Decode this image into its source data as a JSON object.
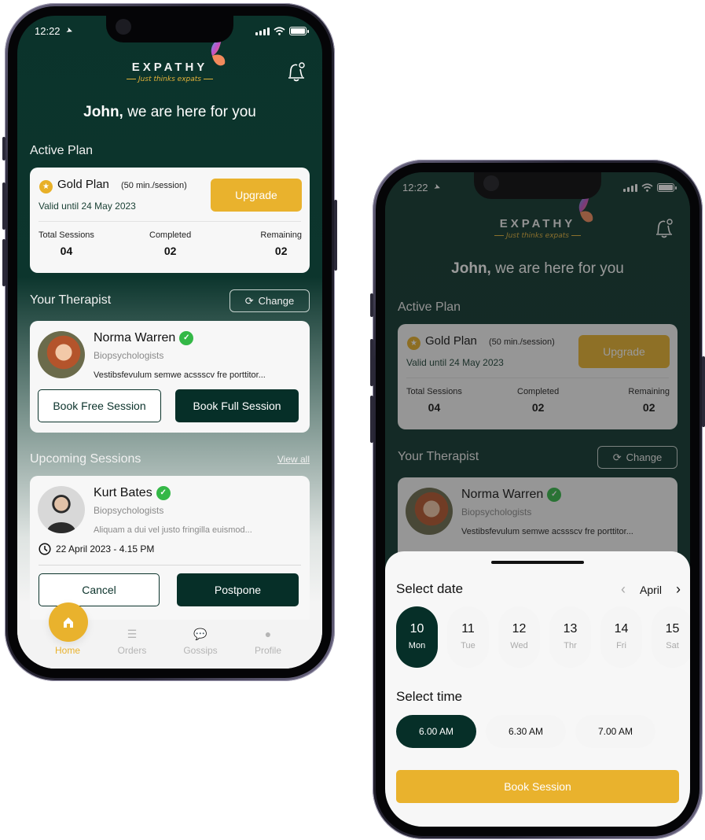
{
  "status_bar": {
    "time": "12:22"
  },
  "header": {
    "brand": "EXPATHY",
    "tagline": "Just thinks expats",
    "greeting_name": "John,",
    "greeting_rest": " we are here for you"
  },
  "active_plan": {
    "section_title": "Active Plan",
    "plan_name": "Gold Plan",
    "plan_duration": "(50 min./session)",
    "valid_until": "Valid until 24 May 2023",
    "upgrade_label": "Upgrade",
    "stats": [
      {
        "label": "Total Sessions",
        "value": "04"
      },
      {
        "label": "Completed",
        "value": "02"
      },
      {
        "label": "Remaining",
        "value": "02"
      }
    ]
  },
  "therapist": {
    "section_title": "Your Therapist",
    "change_label": "Change",
    "name": "Norma Warren",
    "specialty": "Biopsychologists",
    "description": "Vestibsfevulum semwe acssscv fre porttitor...",
    "book_free_label": "Book Free Session",
    "book_full_label": "Book Full Session"
  },
  "upcoming": {
    "section_title": "Upcoming Sessions",
    "view_all_label": "View all",
    "name": "Kurt Bates",
    "specialty": "Biopsychologists",
    "description": "Aliquam a dui vel justo fringilla euismod...",
    "datetime": "22 April 2023 - 4.15 PM",
    "cancel_label": "Cancel",
    "postpone_label": "Postpone"
  },
  "tabbar": {
    "items": [
      {
        "label": "Home",
        "icon": "home-icon",
        "active": true
      },
      {
        "label": "Orders",
        "icon": "list-icon",
        "active": false
      },
      {
        "label": "Gossips",
        "icon": "chat-icon",
        "active": false
      },
      {
        "label": "Profile",
        "icon": "user-icon",
        "active": false
      }
    ]
  },
  "booking_sheet": {
    "date_title": "Select date",
    "month": "April",
    "days": [
      {
        "num": "10",
        "weekday": "Mon",
        "selected": true
      },
      {
        "num": "11",
        "weekday": "Tue",
        "selected": false
      },
      {
        "num": "12",
        "weekday": "Wed",
        "selected": false
      },
      {
        "num": "13",
        "weekday": "Thr",
        "selected": false
      },
      {
        "num": "14",
        "weekday": "Fri",
        "selected": false
      },
      {
        "num": "15",
        "weekday": "Sat",
        "selected": false
      }
    ],
    "time_title": "Select time",
    "times": [
      {
        "label": "6.00  AM",
        "selected": true
      },
      {
        "label": "6.30  AM",
        "selected": false
      },
      {
        "label": "7.00  AM",
        "selected": false
      }
    ],
    "book_label": "Book Session"
  },
  "colors": {
    "primary_dark": "#062f28",
    "accent_gold": "#e9b22d",
    "verified_green": "#34b847"
  }
}
